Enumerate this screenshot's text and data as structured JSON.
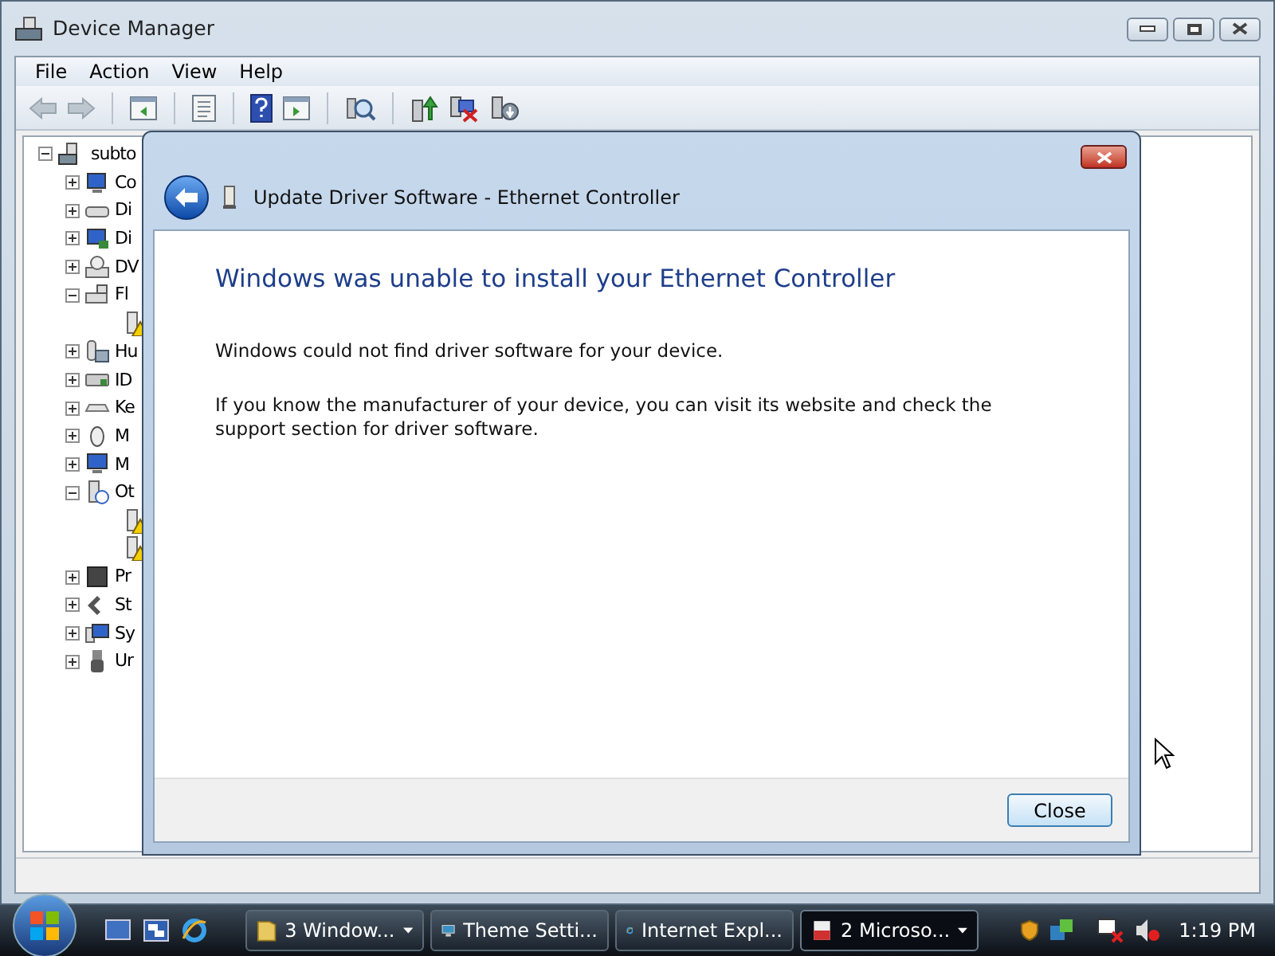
{
  "window": {
    "title": "Device Manager"
  },
  "menu": [
    "File",
    "Action",
    "View",
    "Help"
  ],
  "toolbar": [
    {
      "kind": "back",
      "disabled": true
    },
    {
      "kind": "forward",
      "disabled": true
    },
    {
      "kind": "sep"
    },
    {
      "kind": "tree"
    },
    {
      "kind": "sep"
    },
    {
      "kind": "props"
    },
    {
      "kind": "sep"
    },
    {
      "kind": "help"
    },
    {
      "kind": "pane"
    },
    {
      "kind": "sep"
    },
    {
      "kind": "scan"
    },
    {
      "kind": "sep"
    },
    {
      "kind": "update"
    },
    {
      "kind": "uninstall"
    },
    {
      "kind": "disable"
    }
  ],
  "tree": {
    "label": "subto",
    "expanded": true,
    "children": [
      {
        "label": "Co",
        "expanded": false
      },
      {
        "label": "Di",
        "expanded": false
      },
      {
        "label": "Di",
        "expanded": false
      },
      {
        "label": "DV",
        "expanded": false
      },
      {
        "label": "Fl",
        "expanded": true,
        "children": [
          {
            "warning": true
          }
        ]
      },
      {
        "label": "Hu",
        "expanded": false
      },
      {
        "label": "ID",
        "expanded": false
      },
      {
        "label": "Ke",
        "expanded": false
      },
      {
        "label": "M",
        "expanded": false
      },
      {
        "label": "M",
        "expanded": false
      },
      {
        "label": "Ot",
        "expanded": true,
        "children": [
          {
            "warning": true
          },
          {
            "warning": true
          }
        ]
      },
      {
        "label": "Pr",
        "expanded": false
      },
      {
        "label": "St",
        "expanded": false
      },
      {
        "label": "Sy",
        "expanded": false
      },
      {
        "label": "Ur",
        "expanded": false
      }
    ]
  },
  "dialog": {
    "title": "Update Driver Software - Ethernet Controller",
    "heading": "Windows was unable to install your Ethernet Controller",
    "paragraphs": [
      "Windows could not find driver software for your device.",
      "If you know the manufacturer of your device, you can visit its website and check the support section for driver software."
    ],
    "button": "Close"
  },
  "taskbar": {
    "tasks": [
      {
        "label": "3 Window...",
        "kind": "folder",
        "grouped": true,
        "selected": false
      },
      {
        "label": "Theme Setti...",
        "kind": "display",
        "grouped": false,
        "selected": false
      },
      {
        "label": "Internet Expl...",
        "kind": "browser",
        "grouped": false,
        "selected": false
      },
      {
        "label": "2 Microso...",
        "kind": "document",
        "grouped": true,
        "selected": true
      }
    ],
    "clock": "1:19 PM"
  }
}
